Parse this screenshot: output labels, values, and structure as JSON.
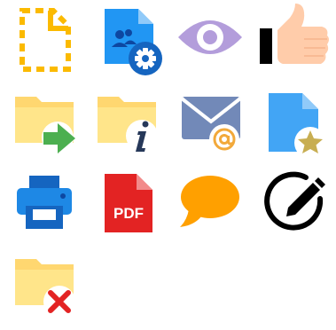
{
  "icons": [
    {
      "name": "dashed-document-icon",
      "color": "#FBBA00"
    },
    {
      "name": "shared-document-settings-icon",
      "color": "#2196F3"
    },
    {
      "name": "eye-icon",
      "color": "#B39DDB"
    },
    {
      "name": "thumbs-up-icon",
      "color": "#FFCCAA"
    },
    {
      "name": "folder-move-icon",
      "color": "#FFD770"
    },
    {
      "name": "folder-info-icon",
      "color": "#FFD770"
    },
    {
      "name": "email-at-icon",
      "color": "#7289B8"
    },
    {
      "name": "document-star-icon",
      "color": "#42A5F5"
    },
    {
      "name": "printer-icon",
      "color": "#1565C0"
    },
    {
      "name": "pdf-file-icon",
      "color": "#E32323",
      "label": "PDF"
    },
    {
      "name": "speech-bubble-icon",
      "color": "#FFA000"
    },
    {
      "name": "edit-circle-icon",
      "color": "#000000"
    },
    {
      "name": "folder-delete-icon",
      "color": "#FFD770"
    }
  ]
}
